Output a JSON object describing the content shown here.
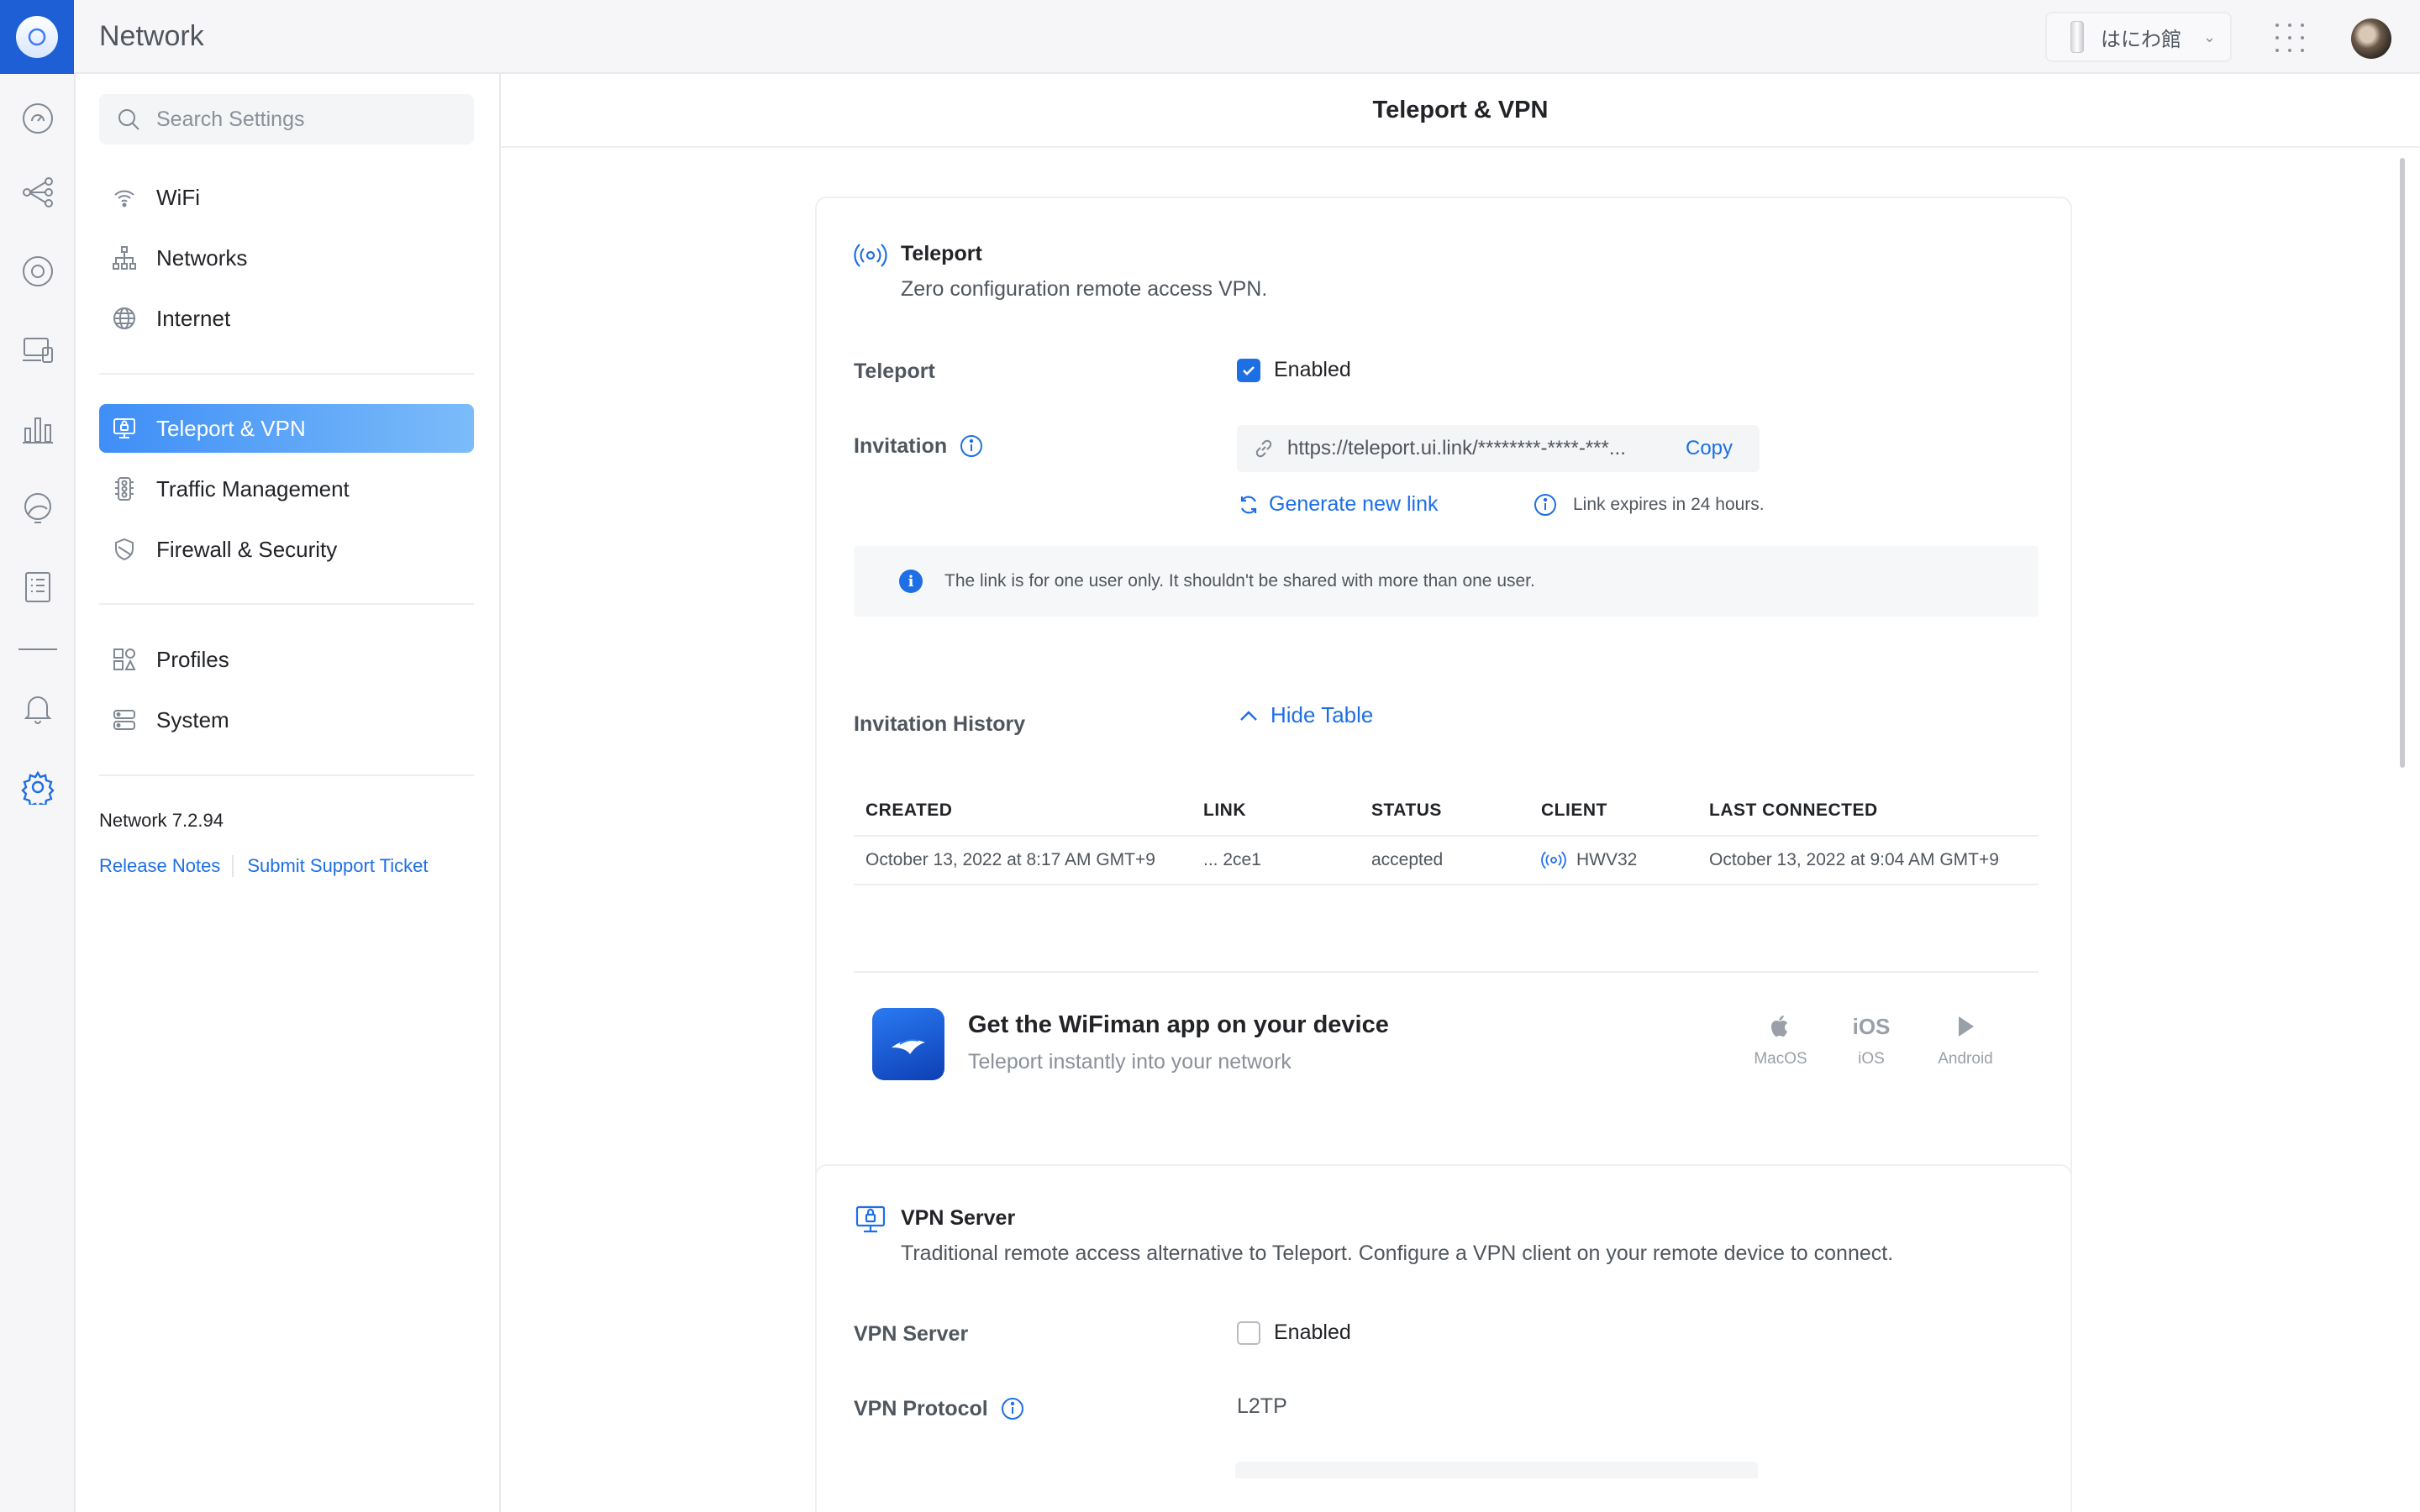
{
  "app": {
    "title": "Network",
    "site_name": "はにわ館"
  },
  "search": {
    "placeholder": "Search Settings"
  },
  "sidebar": {
    "items": [
      {
        "label": "WiFi",
        "icon": "wifi-icon"
      },
      {
        "label": "Networks",
        "icon": "networks-icon"
      },
      {
        "label": "Internet",
        "icon": "globe-icon"
      },
      {
        "label": "Teleport & VPN",
        "icon": "vpn-icon",
        "active": true
      },
      {
        "label": "Traffic Management",
        "icon": "traffic-icon"
      },
      {
        "label": "Firewall & Security",
        "icon": "shield-icon"
      },
      {
        "label": "Profiles",
        "icon": "profiles-icon"
      },
      {
        "label": "System",
        "icon": "system-icon"
      }
    ],
    "version": "Network 7.2.94",
    "links": {
      "release_notes": "Release Notes",
      "support": "Submit Support Ticket"
    }
  },
  "page": {
    "title": "Teleport & VPN"
  },
  "teleport": {
    "title": "Teleport",
    "description": "Zero configuration remote access VPN.",
    "teleport_label": "Teleport",
    "enabled_label": "Enabled",
    "enabled": true,
    "invitation_label": "Invitation",
    "invitation_url": "https://teleport.ui.link/********-****-***...",
    "copy_label": "Copy",
    "generate_label": "Generate new link",
    "expires_text": "Link expires in 24 hours.",
    "notice": "The link is for one user only. It shouldn't be shared with more than one user.",
    "history_label": "Invitation History",
    "hide_table_label": "Hide Table",
    "table": {
      "headers": [
        "CREATED",
        "LINK",
        "STATUS",
        "CLIENT",
        "LAST CONNECTED"
      ],
      "rows": [
        {
          "created": "October 13, 2022 at 8:17 AM GMT+9",
          "link": "... 2ce1",
          "status": "accepted",
          "client": "HWV32",
          "last_connected": "October 13, 2022 at 9:04 AM GMT+9"
        }
      ]
    },
    "wifiman": {
      "title": "Get the WiFiman app on your device",
      "subtitle": "Teleport instantly into your network",
      "platforms": [
        {
          "label": "MacOS",
          "icon": "apple-icon"
        },
        {
          "label": "iOS",
          "icon_text": "iOS"
        },
        {
          "label": "Android",
          "icon": "play-store-icon"
        }
      ]
    }
  },
  "vpn_server": {
    "title": "VPN Server",
    "description": "Traditional remote access alternative to Teleport. Configure a VPN client on your remote device to connect.",
    "server_label": "VPN Server",
    "enabled_label": "Enabled",
    "enabled": false,
    "protocol_label": "VPN Protocol",
    "protocol_value": "L2TP"
  },
  "colors": {
    "accent": "#1e6fe6",
    "active_nav_start": "#3e8ef7",
    "active_nav_end": "#7bbcf9",
    "logo_bg": "#1e5fd6"
  }
}
